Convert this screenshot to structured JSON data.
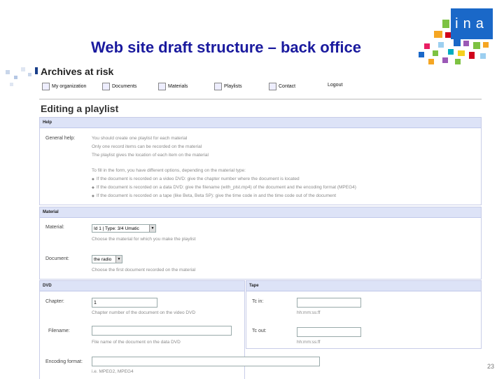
{
  "slide": {
    "title": "Web site draft structure – back office",
    "page_number": "23"
  },
  "logo": {
    "text": "ina"
  },
  "app": {
    "title": "Archives at risk",
    "nav": [
      {
        "label": "My organization",
        "icon": "organization-icon"
      },
      {
        "label": "Documents",
        "icon": "document-icon"
      },
      {
        "label": "Materials",
        "icon": "materials-icon"
      },
      {
        "label": "Playlists",
        "icon": "playlist-icon"
      },
      {
        "label": "Contact",
        "icon": "contact-icon"
      },
      {
        "label": "Logout",
        "icon": ""
      }
    ],
    "page_heading": "Editing a playlist"
  },
  "help": {
    "header": "Help",
    "label": "General help:",
    "lines": [
      "You should create one playlist for each material",
      "Only one record items can be recorded on the material",
      "The playlist gives the location of each item on the material",
      "To fill in the form, you have different options, depending on the material type:"
    ],
    "bullets": [
      "If the document is recorded on a video DVD: give the chapter number where the document is located",
      "If the document is recorded on a data DVD: give the filename (with_plst.mp4) of the document and the encoding format (MPEG4)",
      "If the document is recorded on a tape (like Beta, Beta SP): give the time code in and the time code out of the document"
    ]
  },
  "material": {
    "header": "Material",
    "material_label": "Material:",
    "material_value": "Id 1 | Type: 3/4 Umatic",
    "material_hint": "Choose the material for which you make the playlist",
    "document_label": "Document:",
    "document_value": "the radio",
    "document_hint": "Choose the first document recorded on the material"
  },
  "dvd": {
    "header": "DVD",
    "chapter_label": "Chapter:",
    "chapter_value": "1",
    "chapter_hint": "Chapter number of the document on the video DVD",
    "filename_label": "Filename:",
    "filename_hint": "File name of the document on the data DVD",
    "encoding_label": "Encoding format:",
    "encoding_hint": "i.e. MPEG2, MPEG4"
  },
  "tape": {
    "header": "Tape",
    "tc_in_label": "Tc in:",
    "tc_in_hint": "hh:mm:ss:ff",
    "tc_out_label": "Tc out:",
    "tc_out_hint": "hh:mm:ss:ff"
  }
}
